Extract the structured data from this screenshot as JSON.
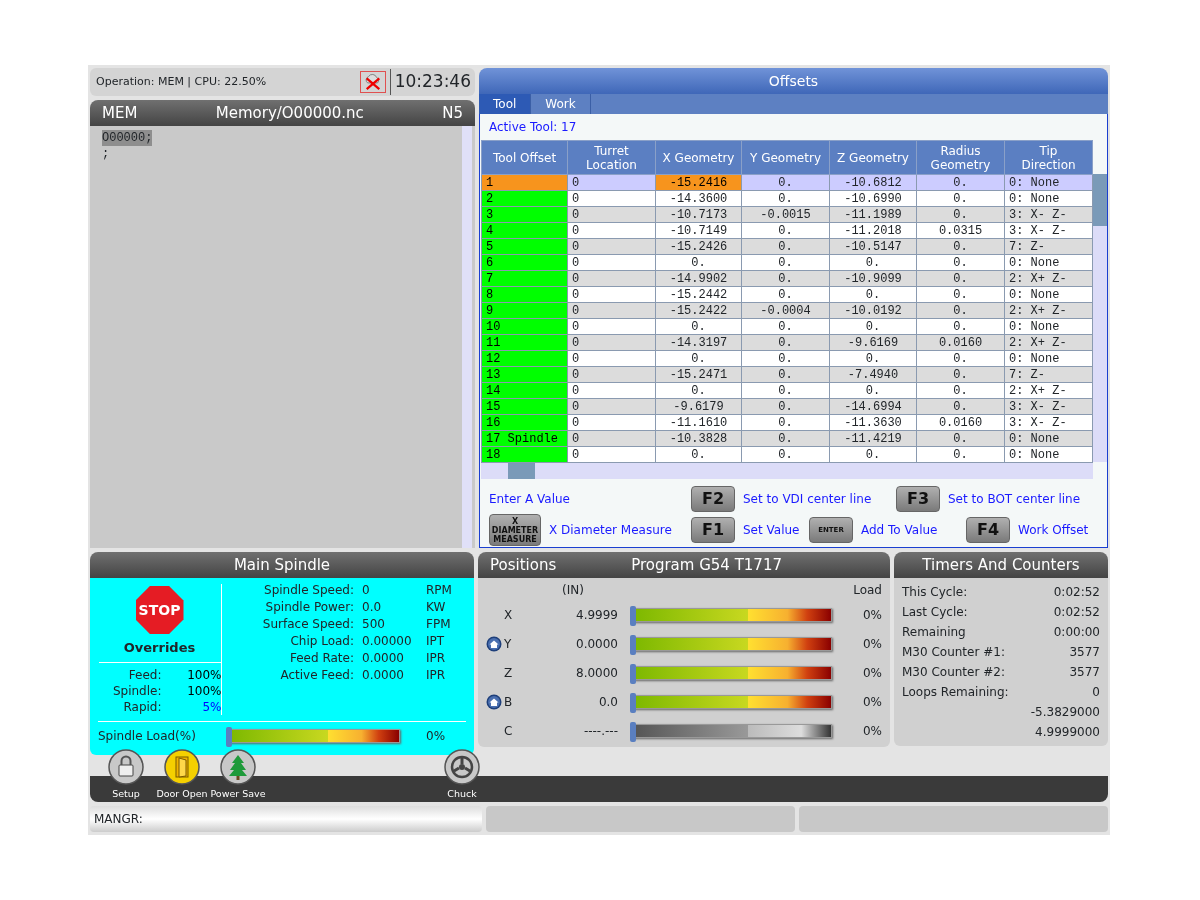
{
  "status_bar": {
    "operation": "Operation: MEM | CPU: 22.50%",
    "clock": "10:23:46"
  },
  "program": {
    "mode": "MEM",
    "file": "Memory/O00000.nc",
    "line": "N5",
    "lines": [
      {
        "text": "O00000;",
        "selected": true
      },
      {
        "text": ";",
        "selected": false
      }
    ]
  },
  "offsets": {
    "title": "Offsets",
    "tabs": [
      {
        "label": "Tool",
        "selected": true
      },
      {
        "label": "Work",
        "selected": false
      }
    ],
    "active_tool": "Active Tool: 17",
    "columns": [
      {
        "label": "Tool Offset",
        "selected": false
      },
      {
        "label": "Turret Location",
        "selected": false
      },
      {
        "label": "X Geometry",
        "selected": true
      },
      {
        "label": "Y Geometry",
        "selected": false
      },
      {
        "label": "Z Geometry",
        "selected": false
      },
      {
        "label": "Radius Geometry",
        "selected": false
      },
      {
        "label": "Tip Direction",
        "selected": false
      }
    ],
    "rows": [
      {
        "cells": [
          "1",
          "0",
          "-15.2416",
          "0.",
          "-10.6812",
          "0.",
          "0: None"
        ],
        "selected": true
      },
      {
        "cells": [
          "2",
          "0",
          "-14.3600",
          "0.",
          "-10.6990",
          "0.",
          "0: None"
        ],
        "selected": false
      },
      {
        "cells": [
          "3",
          "0",
          "-10.7173",
          "-0.0015",
          "-11.1989",
          "0.",
          "3: X- Z-"
        ],
        "selected": false
      },
      {
        "cells": [
          "4",
          "0",
          "-10.7149",
          "0.",
          "-11.2018",
          "0.0315",
          "3: X- Z-"
        ],
        "selected": false
      },
      {
        "cells": [
          "5",
          "0",
          "-15.2426",
          "0.",
          "-10.5147",
          "0.",
          "7: Z-"
        ],
        "selected": false
      },
      {
        "cells": [
          "6",
          "0",
          "0.",
          "0.",
          "0.",
          "0.",
          "0: None"
        ],
        "selected": false
      },
      {
        "cells": [
          "7",
          "0",
          "-14.9902",
          "0.",
          "-10.9099",
          "0.",
          "2: X+ Z-"
        ],
        "selected": false
      },
      {
        "cells": [
          "8",
          "0",
          "-15.2442",
          "0.",
          "0.",
          "0.",
          "0: None"
        ],
        "selected": false
      },
      {
        "cells": [
          "9",
          "0",
          "-15.2422",
          "-0.0004",
          "-10.0192",
          "0.",
          "2: X+ Z-"
        ],
        "selected": false
      },
      {
        "cells": [
          "10",
          "0",
          "0.",
          "0.",
          "0.",
          "0.",
          "0: None"
        ],
        "selected": false
      },
      {
        "cells": [
          "11",
          "0",
          "-14.3197",
          "0.",
          "-9.6169",
          "0.0160",
          "2: X+ Z-"
        ],
        "selected": false
      },
      {
        "cells": [
          "12",
          "0",
          "0.",
          "0.",
          "0.",
          "0.",
          "0: None"
        ],
        "selected": false
      },
      {
        "cells": [
          "13",
          "0",
          "-15.2471",
          "0.",
          "-7.4940",
          "0.",
          "7: Z-"
        ],
        "selected": false
      },
      {
        "cells": [
          "14",
          "0",
          "0.",
          "0.",
          "0.",
          "0.",
          "2: X+ Z-"
        ],
        "selected": false
      },
      {
        "cells": [
          "15",
          "0",
          "-9.6179",
          "0.",
          "-14.6994",
          "0.",
          "3: X- Z-"
        ],
        "selected": false
      },
      {
        "cells": [
          "16",
          "0",
          "-11.1610",
          "0.",
          "-11.3630",
          "0.0160",
          "3: X- Z-"
        ],
        "selected": false
      },
      {
        "cells": [
          "17 Spindle",
          "0",
          "-10.3828",
          "0.",
          "-11.4219",
          "0.",
          "0: None"
        ],
        "selected": false
      },
      {
        "cells": [
          "18",
          "0",
          "0.",
          "0.",
          "0.",
          "0.",
          "0: None"
        ],
        "selected": false
      }
    ],
    "prompt": "Enter A Value",
    "softkey_rows": [
      {
        "keys": [
          {
            "key": "F2",
            "label": "Set to VDI center line",
            "kind": "fkey"
          },
          {
            "key": "F3",
            "label": "Set to BOT center line",
            "kind": "fkey"
          }
        ]
      },
      {
        "keys": [
          {
            "key": "X DIAMETER MEASURE",
            "label": "X Diameter Measure",
            "kind": "multiline"
          },
          {
            "key": "F1",
            "label": "Set Value",
            "kind": "fkey"
          },
          {
            "key": "ENTER",
            "label": "Add To Value",
            "kind": "key"
          },
          {
            "key": "F4",
            "label": "Work Offset",
            "kind": "fkey"
          }
        ]
      }
    ]
  },
  "spindle": {
    "title": "Main Spindle",
    "stop": "STOP",
    "overrides_title": "Overrides",
    "overrides": [
      {
        "label": "Feed:",
        "value": "100%",
        "color": "#000000"
      },
      {
        "label": "Spindle:",
        "value": "100%",
        "color": "#000000"
      },
      {
        "label": "Rapid:",
        "value": "5%",
        "color": "#0000ff"
      }
    ],
    "readings": [
      {
        "label": "Spindle Speed:",
        "value": "0",
        "unit": "RPM"
      },
      {
        "label": "Spindle Power:",
        "value": "0.0",
        "unit": "KW"
      },
      {
        "label": "Surface Speed:",
        "value": "500",
        "unit": "FPM"
      },
      {
        "label": "Chip Load:",
        "value": "0.00000",
        "unit": "IPT"
      },
      {
        "label": "Feed Rate:",
        "value": "0.0000",
        "unit": "IPR"
      },
      {
        "label": "Active Feed:",
        "value": "0.0000",
        "unit": "IPR"
      }
    ],
    "load": {
      "label": "Spindle Load(%)",
      "level": 0,
      "reading": "0%"
    }
  },
  "positions": {
    "title": "Positions",
    "program": "Program G54 T1717",
    "units": "(IN)",
    "load_header": "Load",
    "axes": [
      {
        "name": "X",
        "value": "4.9999",
        "homed": false,
        "enabled": true,
        "level": 0,
        "reading": "0%"
      },
      {
        "name": "Y",
        "value": "0.0000",
        "homed": true,
        "enabled": true,
        "level": 0,
        "reading": "0%"
      },
      {
        "name": "Z",
        "value": "8.0000",
        "homed": false,
        "enabled": true,
        "level": 0,
        "reading": "0%"
      },
      {
        "name": "B",
        "value": "0.0",
        "homed": true,
        "enabled": true,
        "level": 0,
        "reading": "0%"
      },
      {
        "name": "C",
        "value": "----.---",
        "homed": false,
        "enabled": false,
        "level": 0,
        "reading": "0%"
      }
    ]
  },
  "timers": {
    "title": "Timers And Counters",
    "rows": [
      {
        "label": "This Cycle:",
        "value": "0:02:52"
      },
      {
        "label": "Last Cycle:",
        "value": "0:02:52"
      },
      {
        "label": "Remaining",
        "value": "0:00:00"
      },
      {
        "label": "M30 Counter #1:",
        "value": "3577"
      },
      {
        "label": "M30 Counter #2:",
        "value": "3577"
      },
      {
        "label": "Loops Remaining:",
        "value": "0"
      },
      {
        "value": "-5.3829000"
      },
      {
        "value": "4.9999000"
      }
    ]
  },
  "icon_bar": {
    "buttons": [
      {
        "label": "Setup",
        "kind": "lock",
        "active": false
      },
      {
        "label": "Door Open",
        "kind": "door",
        "active": true
      },
      {
        "label": "Power Save",
        "kind": "tree",
        "active": false
      },
      {
        "label": "Chuck",
        "kind": "chuck",
        "active": false
      }
    ]
  },
  "command_line": {
    "prompt": "MANGR:"
  }
}
